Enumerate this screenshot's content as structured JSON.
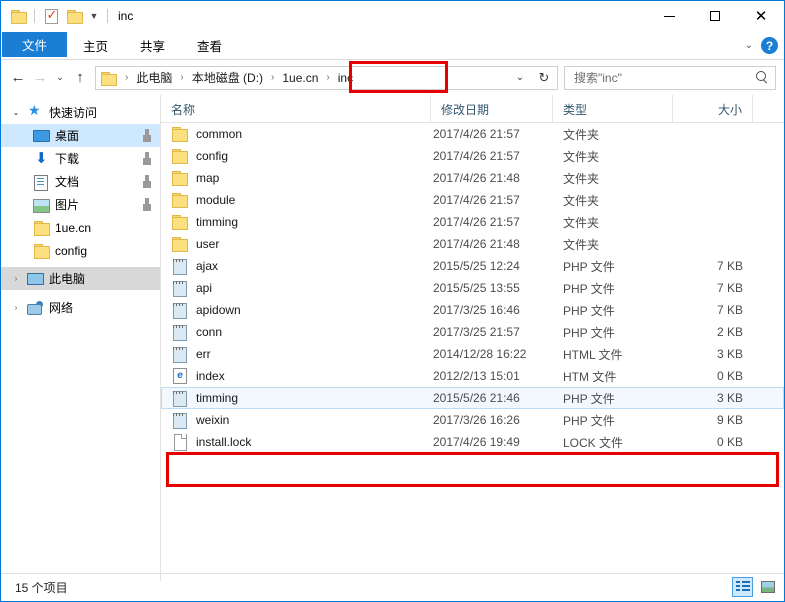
{
  "window": {
    "title": "inc",
    "quick_access_icons": [
      "folder-icon",
      "properties-check-icon",
      "new-folder-icon",
      "customize-chevron-icon"
    ],
    "controls": {
      "minimize": "—",
      "maximize": "▢",
      "close": "✕"
    }
  },
  "ribbon": {
    "tabs": [
      {
        "label": "文件",
        "active": true
      },
      {
        "label": "主页",
        "active": false
      },
      {
        "label": "共享",
        "active": false
      },
      {
        "label": "查看",
        "active": false
      }
    ],
    "expand_chevron": "⌄",
    "help_label": "?"
  },
  "address": {
    "back": "←",
    "forward": "→",
    "recent_chevron": "⌄",
    "up": "↑",
    "crumbs": [
      "此电脑",
      "本地磁盘 (D:)",
      "1ue.cn",
      "inc"
    ],
    "separator": "›",
    "dropdown": "⌄",
    "refresh": "↻"
  },
  "search": {
    "placeholder": "搜索\"inc\"",
    "value": "搜索\"inc\"",
    "icon": "search-icon"
  },
  "sidebar": {
    "items": [
      {
        "label": "快速访问",
        "icon": "star-icon",
        "caret": "⌄",
        "level": 0,
        "state": "expanded",
        "pinned": false
      },
      {
        "label": "桌面",
        "icon": "desktop-icon",
        "caret": "",
        "level": 1,
        "state": "selected",
        "pinned": true
      },
      {
        "label": "下载",
        "icon": "download-icon",
        "caret": "",
        "level": 1,
        "state": "normal",
        "pinned": true
      },
      {
        "label": "文档",
        "icon": "documents-icon",
        "caret": "",
        "level": 1,
        "state": "normal",
        "pinned": true
      },
      {
        "label": "图片",
        "icon": "pictures-icon",
        "caret": "",
        "level": 1,
        "state": "normal",
        "pinned": true
      },
      {
        "label": "1ue.cn",
        "icon": "folder-icon",
        "caret": "",
        "level": 1,
        "state": "normal",
        "pinned": false
      },
      {
        "label": "config",
        "icon": "folder-icon",
        "caret": "",
        "level": 1,
        "state": "normal",
        "pinned": false
      },
      {
        "label": "此电脑",
        "icon": "this-pc-icon",
        "caret": "›",
        "level": 0,
        "state": "hovered",
        "pinned": false
      },
      {
        "label": "网络",
        "icon": "network-icon",
        "caret": "›",
        "level": 0,
        "state": "normal",
        "pinned": false
      }
    ]
  },
  "filelist": {
    "columns": [
      {
        "key": "name",
        "label": "名称"
      },
      {
        "key": "date",
        "label": "修改日期"
      },
      {
        "key": "type",
        "label": "类型"
      },
      {
        "key": "size",
        "label": "大小"
      }
    ],
    "sort_caret": "⌃",
    "rows": [
      {
        "name": "common",
        "date": "2017/4/26 21:57",
        "type": "文件夹",
        "size": "",
        "icon": "folder-icon",
        "ico_class": "t-folder",
        "state": "normal"
      },
      {
        "name": "config",
        "date": "2017/4/26 21:57",
        "type": "文件夹",
        "size": "",
        "icon": "folder-icon",
        "ico_class": "t-folder",
        "state": "normal"
      },
      {
        "name": "map",
        "date": "2017/4/26 21:48",
        "type": "文件夹",
        "size": "",
        "icon": "folder-icon",
        "ico_class": "t-folder",
        "state": "normal"
      },
      {
        "name": "module",
        "date": "2017/4/26 21:57",
        "type": "文件夹",
        "size": "",
        "icon": "folder-icon",
        "ico_class": "t-folder",
        "state": "normal"
      },
      {
        "name": "timming",
        "date": "2017/4/26 21:57",
        "type": "文件夹",
        "size": "",
        "icon": "folder-icon",
        "ico_class": "t-folder",
        "state": "normal"
      },
      {
        "name": "user",
        "date": "2017/4/26 21:48",
        "type": "文件夹",
        "size": "",
        "icon": "folder-icon",
        "ico_class": "t-folder",
        "state": "normal"
      },
      {
        "name": "ajax",
        "date": "2015/5/25 12:24",
        "type": "PHP 文件",
        "size": "7 KB",
        "icon": "php-file-icon",
        "ico_class": "t-php",
        "state": "normal"
      },
      {
        "name": "api",
        "date": "2015/5/25 13:55",
        "type": "PHP 文件",
        "size": "7 KB",
        "icon": "php-file-icon",
        "ico_class": "t-php",
        "state": "normal"
      },
      {
        "name": "apidown",
        "date": "2017/3/25 16:46",
        "type": "PHP 文件",
        "size": "7 KB",
        "icon": "php-file-icon",
        "ico_class": "t-php",
        "state": "normal"
      },
      {
        "name": "conn",
        "date": "2017/3/25 21:57",
        "type": "PHP 文件",
        "size": "2 KB",
        "icon": "php-file-icon",
        "ico_class": "t-php",
        "state": "normal"
      },
      {
        "name": "err",
        "date": "2014/12/28 16:22",
        "type": "HTML 文件",
        "size": "3 KB",
        "icon": "html-file-icon",
        "ico_class": "t-php",
        "state": "normal"
      },
      {
        "name": "index",
        "date": "2012/2/13 15:01",
        "type": "HTM 文件",
        "size": "0 KB",
        "icon": "htm-file-icon",
        "ico_class": "t-htm",
        "state": "normal"
      },
      {
        "name": "timming",
        "date": "2015/5/26 21:46",
        "type": "PHP 文件",
        "size": "3 KB",
        "icon": "php-file-icon",
        "ico_class": "t-php",
        "state": "hovered"
      },
      {
        "name": "weixin",
        "date": "2017/3/26 16:26",
        "type": "PHP 文件",
        "size": "9 KB",
        "icon": "php-file-icon",
        "ico_class": "t-php",
        "state": "normal"
      },
      {
        "name": "install.lock",
        "date": "2017/4/26 19:49",
        "type": "LOCK 文件",
        "size": "0 KB",
        "icon": "lock-file-icon",
        "ico_class": "t-lock",
        "state": "normal"
      }
    ]
  },
  "annotations": {
    "color": "#e60000",
    "boxes": [
      {
        "target": "breadcrumb-inc"
      },
      {
        "target": "row-install-lock"
      }
    ]
  },
  "statusbar": {
    "item_count": "15 个项目",
    "view_details_label": "details-view",
    "view_tiles_label": "large-icons-view"
  }
}
